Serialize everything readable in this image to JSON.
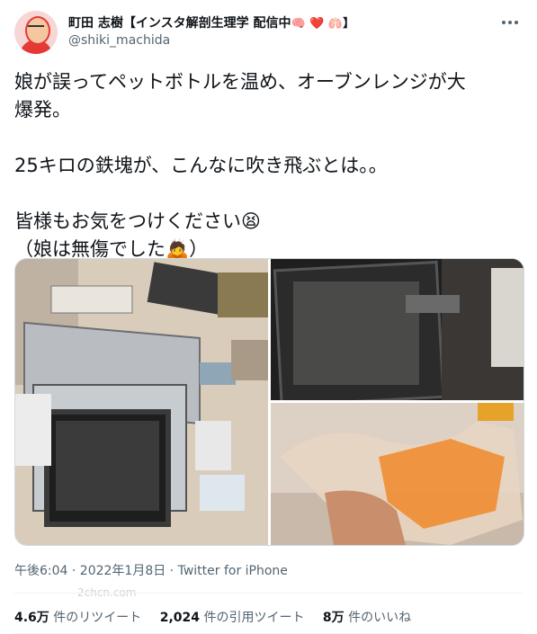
{
  "author": {
    "display_name": "町田 志樹【インスタ解剖生理学 配信中",
    "name_emojis": "🧠 ❤️ 🫁】",
    "handle": "@shiki_machida"
  },
  "more_icon": "more-icon",
  "tweet": {
    "line1": "娘が誤ってペットボトルを温め、オーブンレンジが大",
    "line2": "爆発。",
    "line3": "25キロの鉄塊が、こんなに吹き飛ぶとは。。",
    "line4": "皆様もお気をつけください😫",
    "line5": "（娘は無傷でした🙇）"
  },
  "meta": {
    "time": "午後6:04 · 2022年1月8日 · ",
    "source": "Twitter for iPhone"
  },
  "stats": {
    "retweets_value": "4.6万",
    "retweets_label": "件のリツイート",
    "quotes_value": "2,024",
    "quotes_label": "件の引用ツイート",
    "likes_value": "8万",
    "likes_label": "件のいいね"
  },
  "watermark": "2chcn.com"
}
